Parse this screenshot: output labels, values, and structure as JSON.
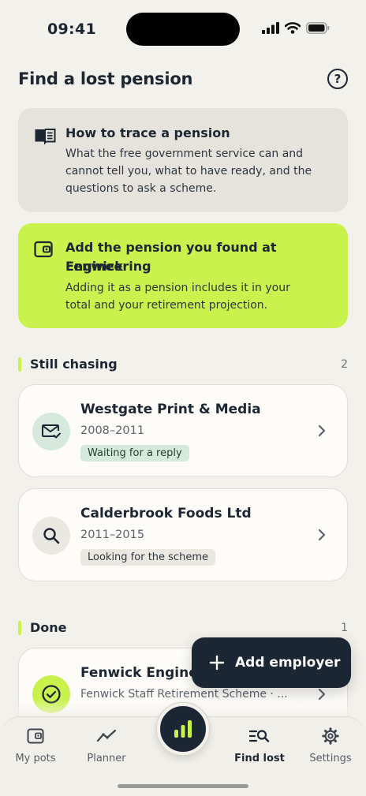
{
  "status_bar": {
    "time": "09:41"
  },
  "header": {
    "title": "Find a lost pension",
    "help_icon": "help-circle-icon"
  },
  "info_card": {
    "icon": "book-icon",
    "title": "How to trace a pension",
    "lines": [
      "What the free government service can and",
      "cannot tell you, what to have ready, and the",
      "questions to ask a scheme."
    ]
  },
  "add_card": {
    "icon": "wallet-icon",
    "title_lines": [
      "Add the pension you found at Fenwick",
      "Engineering"
    ],
    "lines": [
      "Adding it as a pension includes it in your",
      "total and your retirement projection."
    ],
    "color": "#c9f24d"
  },
  "sections": {
    "chasing": {
      "title": "Still chasing",
      "count": "2"
    },
    "done": {
      "title": "Done",
      "count": "1"
    }
  },
  "employers": [
    {
      "name": "Westgate Print & Media",
      "years": "2008–2011",
      "status": "Waiting for a reply",
      "icon": "mail-check-icon"
    },
    {
      "name": "Calderbrook Foods Ltd",
      "years": "2011–2015",
      "status": "Looking for the scheme",
      "icon": "search-icon"
    },
    {
      "name": "Fenwick Engine",
      "scheme": "Fenwick Staff Retirement Scheme · ...",
      "icon": "check-circle-icon"
    }
  ],
  "fab": {
    "label": "Add employer"
  },
  "tab_bar": {
    "tabs": [
      {
        "label": "My pots",
        "icon": "wallet-icon"
      },
      {
        "label": "Planner",
        "icon": "trend-icon"
      },
      {
        "label": "Find lost",
        "icon": "search-list-icon",
        "active": true
      },
      {
        "label": "Settings",
        "icon": "gear-icon"
      }
    ],
    "center_icon": "bar-chart-icon"
  }
}
